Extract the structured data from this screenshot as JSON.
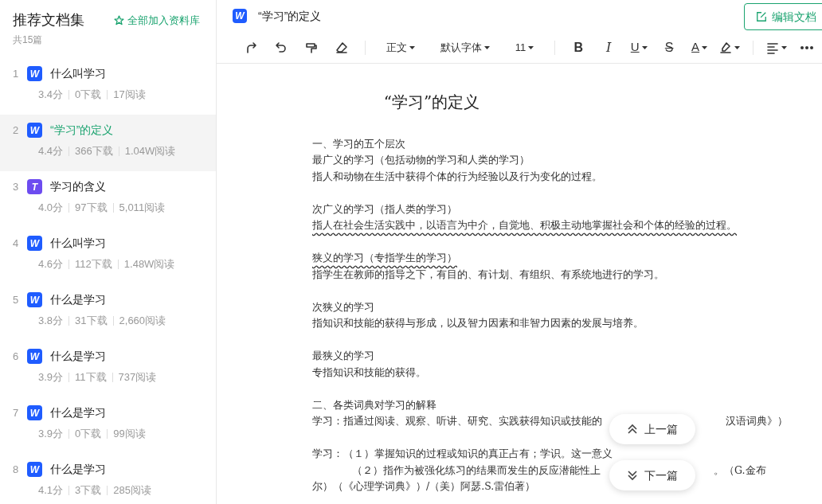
{
  "sidebar": {
    "title": "推荐文档集",
    "add_all": "全部加入资料库",
    "count": "共15篇",
    "items": [
      {
        "index": "1",
        "badge": "W",
        "kind": "word",
        "title": "什么叫学习",
        "score": "3.4分",
        "downloads": "0下载",
        "reads": "17阅读",
        "selected": false
      },
      {
        "index": "2",
        "badge": "W",
        "kind": "word",
        "title": "“学习”的定义",
        "score": "4.4分",
        "downloads": "366下载",
        "reads": "1.04W阅读",
        "selected": true
      },
      {
        "index": "3",
        "badge": "T",
        "kind": "text",
        "title": "学习的含义",
        "score": "4.0分",
        "downloads": "97下载",
        "reads": "5,011阅读",
        "selected": false
      },
      {
        "index": "4",
        "badge": "W",
        "kind": "word",
        "title": "什么叫学习",
        "score": "4.6分",
        "downloads": "112下载",
        "reads": "1.48W阅读",
        "selected": false
      },
      {
        "index": "5",
        "badge": "W",
        "kind": "word",
        "title": "什么是学习",
        "score": "3.8分",
        "downloads": "31下载",
        "reads": "2,660阅读",
        "selected": false
      },
      {
        "index": "6",
        "badge": "W",
        "kind": "word",
        "title": "什么是学习",
        "score": "3.9分",
        "downloads": "11下载",
        "reads": "737阅读",
        "selected": false
      },
      {
        "index": "7",
        "badge": "W",
        "kind": "word",
        "title": "什么是学习",
        "score": "3.9分",
        "downloads": "0下载",
        "reads": "99阅读",
        "selected": false
      },
      {
        "index": "8",
        "badge": "W",
        "kind": "word",
        "title": "什么是学习",
        "score": "4.1分",
        "downloads": "3下载",
        "reads": "285阅读",
        "selected": false
      }
    ]
  },
  "header": {
    "badge": "W",
    "title": "“学习”的定义",
    "edit_button": "编辑文档"
  },
  "toolbar": [
    {
      "kind": "redo"
    },
    {
      "kind": "undo"
    },
    {
      "kind": "painter"
    },
    {
      "kind": "eraser"
    },
    {
      "kind": "divider"
    },
    {
      "kind": "dropdown",
      "label": "正文"
    },
    {
      "kind": "dropdown",
      "label": "默认字体"
    },
    {
      "kind": "dropdown",
      "label": "11"
    },
    {
      "kind": "divider"
    },
    {
      "kind": "bold",
      "label": "B"
    },
    {
      "kind": "italic",
      "label": "I"
    },
    {
      "kind": "underline",
      "label": "U"
    },
    {
      "kind": "strike",
      "label": "S"
    },
    {
      "kind": "fontcolor",
      "label": "A"
    },
    {
      "kind": "highlight"
    },
    {
      "kind": "divider"
    },
    {
      "kind": "align"
    },
    {
      "kind": "more"
    }
  ],
  "document": {
    "title": "“学习”的定义",
    "lines": [
      {
        "kind": "text",
        "parts": [
          "一、学习的五个层次"
        ],
        "wavy_underline": false
      },
      {
        "kind": "text",
        "parts": [
          "最广义的学习（包括动物的学习和人类的学习）"
        ],
        "wavy_underline": false
      },
      {
        "kind": "text",
        "parts": [
          "指人和动物在生活中获得个体的行为经验以及行为变化的过程。"
        ],
        "wavy_underline": false
      },
      {
        "kind": "blank"
      },
      {
        "kind": "text",
        "parts": [
          "次广义的学习（指人类的学习）"
        ],
        "wavy_underline": false
      },
      {
        "kind": "text",
        "parts": [
          "指人在社会生活实践中，以语言为中介，自觉地、积极主动地掌握社会和个体的经验的过程。"
        ],
        "wavy_underline": true
      },
      {
        "kind": "blank"
      },
      {
        "kind": "text",
        "parts": [
          "狭义的学习（专指学生的学习）"
        ],
        "wavy_underline": true
      },
      {
        "kind": "text",
        "parts": [
          "指学生在教师的指导之下，有目的、有计划、有组织、有系统地进行的学习。"
        ],
        "wavy_underline": false
      },
      {
        "kind": "blank"
      },
      {
        "kind": "text",
        "parts": [
          "次狭义的学习"
        ],
        "wavy_underline": false
      },
      {
        "kind": "text",
        "parts": [
          "指知识和技能的获得与形成，以及智力因素和非智力因素的发展与培养。"
        ],
        "wavy_underline": false
      },
      {
        "kind": "blank"
      },
      {
        "kind": "text",
        "parts": [
          "最狭义的学习"
        ],
        "wavy_underline": false
      },
      {
        "kind": "text",
        "parts": [
          "专指知识和技能的获得。"
        ],
        "wavy_underline": false
      },
      {
        "kind": "blank"
      },
      {
        "kind": "text",
        "parts": [
          "二、各类词典对学习的解释"
        ],
        "wavy_underline": false
      },
      {
        "kind": "text",
        "parts": [
          "学习：指通过阅读、观察、听讲、研究、实践获得知识或技能的",
          "汉语词典》）"
        ],
        "wavy_underline": false
      },
      {
        "kind": "blank"
      },
      {
        "kind": "text",
        "parts": [
          "学习：（１）掌握知识的过程或知识的真正占有；学识。这一意义"
        ],
        "wavy_underline": false
      },
      {
        "kind": "indent",
        "parts": [
          "（２）指作为被强化练习的结果而发生的反应潜能性上",
          "。（G.金布"
        ],
        "wavy_underline": false
      },
      {
        "kind": "text",
        "parts": [
          "尔）（《心理学词典》）/（美）阿瑟.S.雷伯著）"
        ],
        "wavy_underline": false
      }
    ]
  },
  "nav": {
    "previous": "上一篇",
    "next": "下一篇"
  }
}
